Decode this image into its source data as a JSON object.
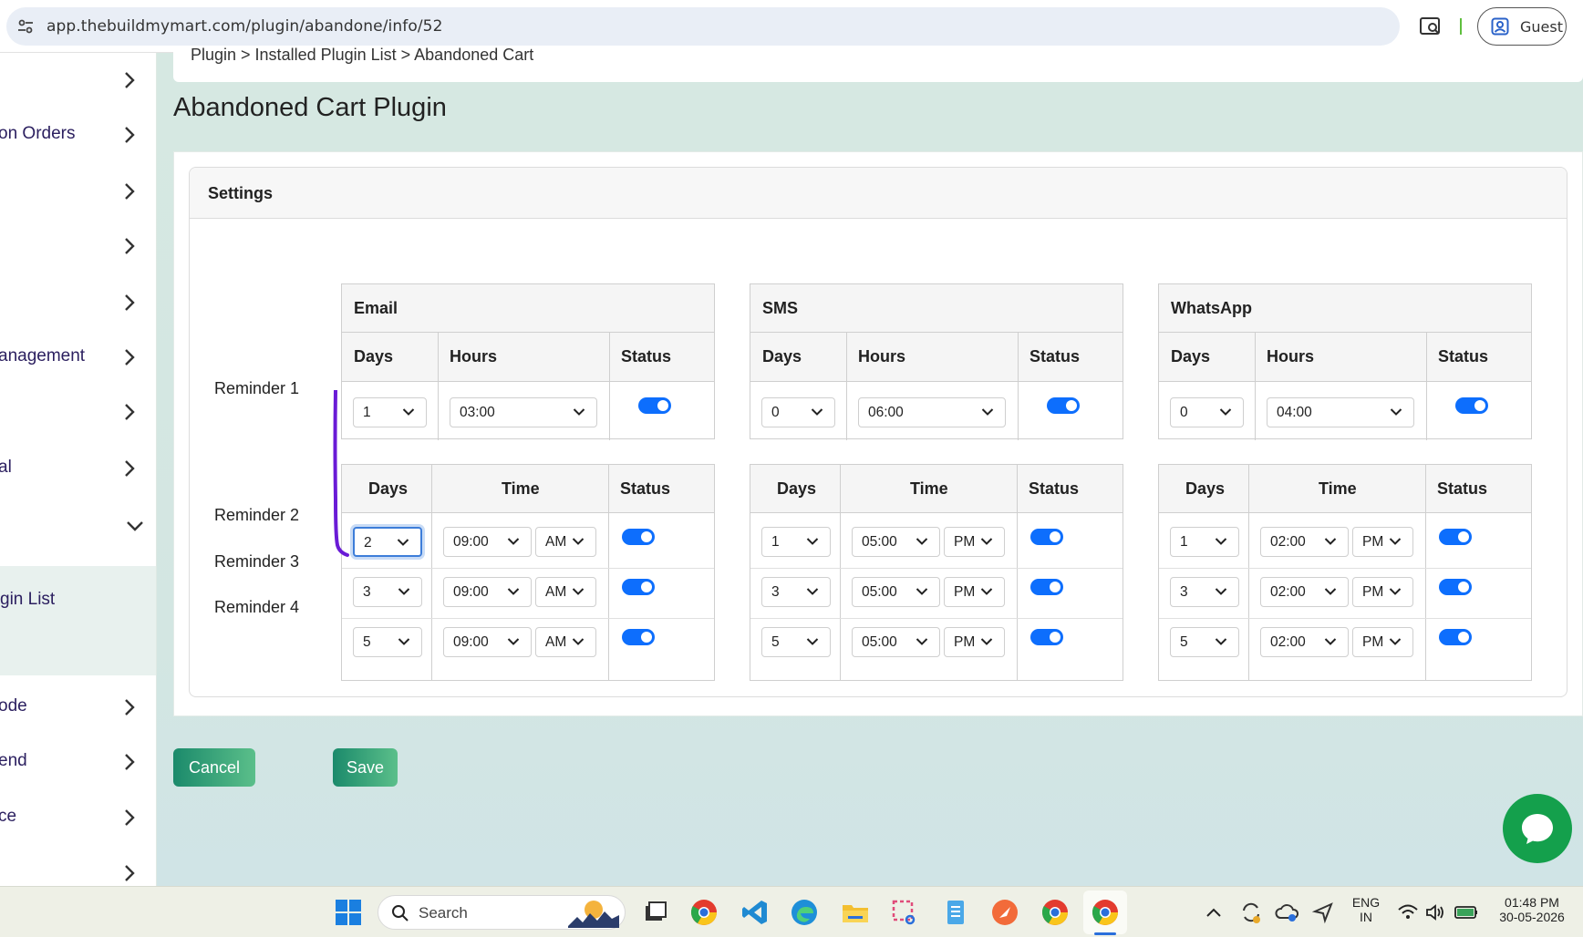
{
  "browser": {
    "url": "app.thebuildmymart.com/plugin/abandone/info/52",
    "profile_label": "Guest"
  },
  "sidebar": {
    "items": [
      {
        "label": ""
      },
      {
        "label": "on Orders"
      },
      {
        "label": ""
      },
      {
        "label": ""
      },
      {
        "label": ""
      },
      {
        "label": "anagement"
      },
      {
        "label": ""
      },
      {
        "label": "al"
      },
      {
        "label": ""
      },
      {
        "label": "ode"
      },
      {
        "label": "end"
      },
      {
        "label": "ce"
      },
      {
        "label": ""
      }
    ],
    "active_sub_label": "gin List"
  },
  "breadcrumb": "Plugin > Installed Plugin List > Abandoned Cart",
  "page_title": "Abandoned Cart Plugin",
  "settings_title": "Settings",
  "reminder_labels": [
    "Reminder 1",
    "Reminder 2",
    "Reminder 3",
    "Reminder 4"
  ],
  "headers": {
    "days": "Days",
    "hours": "Hours",
    "time": "Time",
    "status": "Status"
  },
  "channels": [
    {
      "name": "Email",
      "reminder1": {
        "days": "1",
        "hours": "03:00",
        "status": true
      },
      "later": [
        {
          "days": "2",
          "time": "09:00",
          "ampm": "AM",
          "status": true
        },
        {
          "days": "3",
          "time": "09:00",
          "ampm": "AM",
          "status": true
        },
        {
          "days": "5",
          "time": "09:00",
          "ampm": "AM",
          "status": true
        }
      ]
    },
    {
      "name": "SMS",
      "reminder1": {
        "days": "0",
        "hours": "06:00",
        "status": true
      },
      "later": [
        {
          "days": "1",
          "time": "05:00",
          "ampm": "PM",
          "status": true
        },
        {
          "days": "3",
          "time": "05:00",
          "ampm": "PM",
          "status": true
        },
        {
          "days": "5",
          "time": "05:00",
          "ampm": "PM",
          "status": true
        }
      ]
    },
    {
      "name": "WhatsApp",
      "reminder1": {
        "days": "0",
        "hours": "04:00",
        "status": true
      },
      "later": [
        {
          "days": "1",
          "time": "02:00",
          "ampm": "PM",
          "status": true
        },
        {
          "days": "3",
          "time": "02:00",
          "ampm": "PM",
          "status": true
        },
        {
          "days": "5",
          "time": "02:00",
          "ampm": "PM",
          "status": true
        }
      ]
    }
  ],
  "buttons": {
    "cancel": "Cancel",
    "save": "Save"
  },
  "taskbar": {
    "search_placeholder": "Search",
    "lang_line1": "ENG",
    "lang_line2": "IN",
    "time": "01:48 PM",
    "date": "30-05-2026"
  },
  "colors": {
    "accent": "#0d6efd",
    "button": "#1b8a6b",
    "chat": "#14a04c"
  }
}
